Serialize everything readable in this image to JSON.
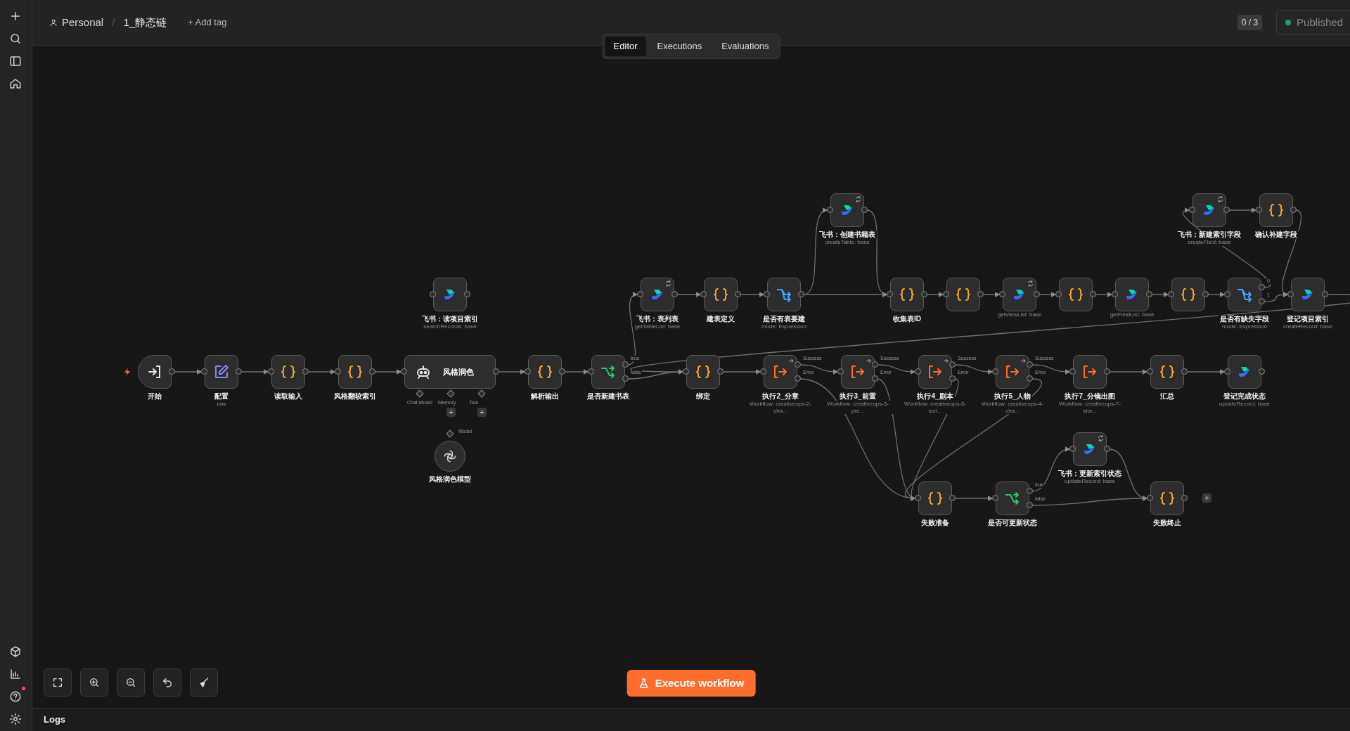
{
  "breadcrumb": {
    "owner": "Personal",
    "separator": "/",
    "workflow": "1_静态链"
  },
  "add_tag": "+ Add tag",
  "counter": "0 / 3",
  "publish": {
    "label": "Published",
    "published": true
  },
  "tabs": [
    {
      "label": "Editor",
      "selected": true
    },
    {
      "label": "Executions",
      "selected": false
    },
    {
      "label": "Evaluations",
      "selected": false
    }
  ],
  "nodes": [
    {
      "kind": "trigger",
      "label": "开始"
    },
    {
      "kind": "set",
      "label": "配置",
      "subtitle": "raw"
    },
    {
      "kind": "code",
      "label": "读取输入"
    },
    {
      "kind": "code",
      "label": "风格翻较索引"
    },
    {
      "kind": "feishu",
      "label": "飞书：读项目索引",
      "subtitle": "searchRecords: base"
    },
    {
      "kind": "agent",
      "label": "风格润色",
      "slots": [
        {
          "label": "Chat Model"
        },
        {
          "label": "Memory",
          "add": "+"
        },
        {
          "label": "Tool",
          "add": "+"
        }
      ]
    },
    {
      "kind": "model",
      "label": "风格润色模型",
      "port_label": "Model"
    },
    {
      "kind": "code",
      "label": "解析输出"
    },
    {
      "kind": "if",
      "label": "是否新建书表",
      "outputs": [
        "true",
        "false"
      ]
    },
    {
      "kind": "feishu",
      "label": "飞书：表列表",
      "subtitle": "getTableList: base",
      "marked": true
    },
    {
      "kind": "code",
      "label": "建表定义"
    },
    {
      "kind": "switch",
      "label": "是否有表要建",
      "subtitle": "mode: Expression"
    },
    {
      "kind": "feishu",
      "label": "飞书：创建书籍表",
      "subtitle": "createTable: base",
      "marked": true
    },
    {
      "kind": "code",
      "label": "收集表ID"
    },
    {
      "kind": "code"
    },
    {
      "kind": "feishu",
      "subtitle": "getViewList: base",
      "marked": true
    },
    {
      "kind": "code"
    },
    {
      "kind": "feishu",
      "subtitle": "getFieldList: base"
    },
    {
      "kind": "code"
    },
    {
      "kind": "switch",
      "label": "是否有缺失字段",
      "subtitle": "mode: Expression",
      "outputs": [
        "0",
        "1"
      ]
    },
    {
      "kind": "feishu",
      "label": "飞书：新建索引字段",
      "subtitle": "createField: base",
      "marked": true
    },
    {
      "kind": "code",
      "label": "确认补建字段"
    },
    {
      "kind": "feishu",
      "label": "登记项目索引",
      "subtitle": "createRecord: base"
    },
    {
      "kind": "code",
      "label": "绑定"
    },
    {
      "kind": "subworkflow",
      "label": "执行2_分章",
      "subtitle": "Workflow: creativeops-2-cha...",
      "marked": true,
      "outputs": [
        "Success",
        "Error"
      ]
    },
    {
      "kind": "subworkflow",
      "label": "执行3_前置",
      "subtitle": "Workflow: creativeops-3-pre...",
      "marked": true,
      "outputs": [
        "Success",
        "Error"
      ]
    },
    {
      "kind": "subworkflow",
      "label": "执行4_剧本",
      "subtitle": "Workflow: creativeops-3-scri...",
      "marked": true,
      "outputs": [
        "Success",
        "Error"
      ]
    },
    {
      "kind": "subworkflow",
      "label": "执行5_人物",
      "subtitle": "Workflow: creativeops-4-cha...",
      "marked": true,
      "outputs": [
        "Success",
        "Error"
      ]
    },
    {
      "kind": "subworkflow",
      "label": "执行7_分镜出图",
      "subtitle": "Workflow: creativeops-7-stor..."
    },
    {
      "kind": "code",
      "label": "汇总"
    },
    {
      "kind": "feishu",
      "label": "登记完成状态",
      "subtitle": "updateRecord: base"
    },
    {
      "kind": "code",
      "label": "失败准备"
    },
    {
      "kind": "if",
      "label": "是否可更新状态",
      "outputs": [
        "true",
        "false"
      ]
    },
    {
      "kind": "feishu",
      "label": "飞书：更新索引状态",
      "subtitle": "updateRecord: base",
      "marked": true
    },
    {
      "kind": "code",
      "label": "失败终止",
      "trailing": "+"
    }
  ],
  "execute_button": "Execute workflow",
  "help_notification": true,
  "logs": "Logs"
}
